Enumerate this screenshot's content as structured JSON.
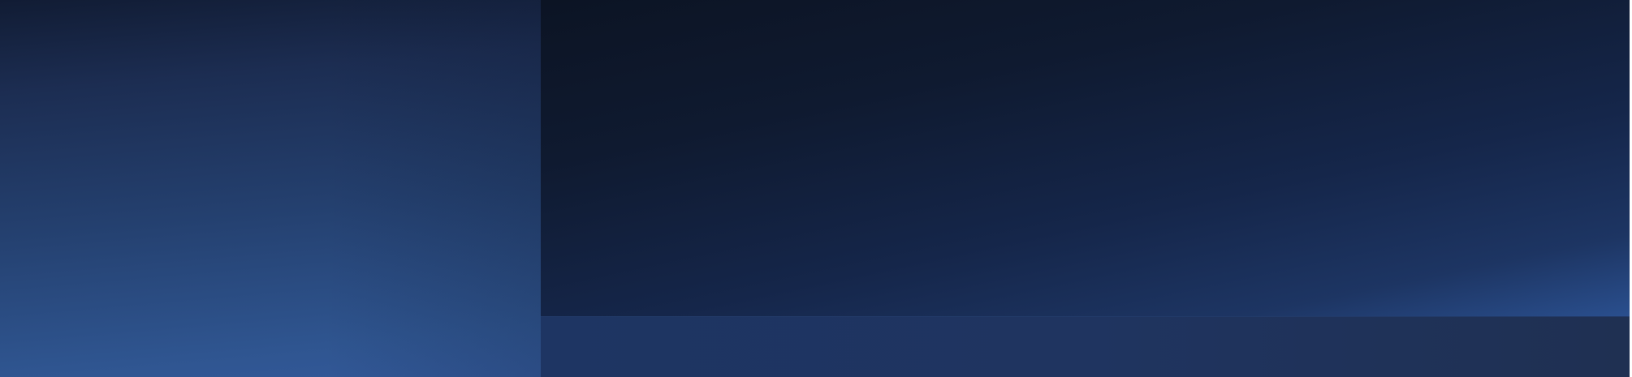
{
  "colors": {
    "left_panel_top": "#111c34",
    "left_panel_bottom": "#33599a",
    "main_panel_top": "#0c1424",
    "main_panel_bottom": "#2a4f8e",
    "footer_band": "#1f3460"
  }
}
